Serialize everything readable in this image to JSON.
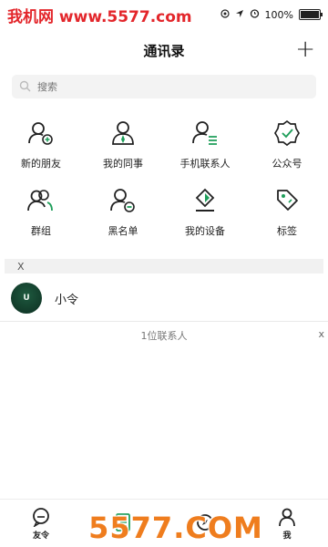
{
  "status_bar": {
    "watermark": "我机网 www.5577.com",
    "battery": "100%"
  },
  "header": {
    "title": "通讯录",
    "add_label": "+"
  },
  "search": {
    "placeholder": "搜索"
  },
  "functions": [
    {
      "label": "新的朋友",
      "icon": "add-friend-icon"
    },
    {
      "label": "我的同事",
      "icon": "colleague-icon"
    },
    {
      "label": "手机联系人",
      "icon": "phone-contacts-icon"
    },
    {
      "label": "公众号",
      "icon": "official-account-icon"
    },
    {
      "label": "群组",
      "icon": "group-icon"
    },
    {
      "label": "黑名单",
      "icon": "blacklist-icon"
    },
    {
      "label": "我的设备",
      "icon": "device-icon"
    },
    {
      "label": "标签",
      "icon": "tag-icon"
    }
  ],
  "section": {
    "letter": "X"
  },
  "contacts": [
    {
      "name": "小令",
      "avatar_text": "U"
    }
  ],
  "footer": {
    "count": "1位联系人",
    "close": "x"
  },
  "tabs": [
    {
      "label": "友令",
      "icon": "chat-icon"
    },
    {
      "label": "",
      "icon": "contacts-icon"
    },
    {
      "label": "",
      "icon": "discover-icon"
    },
    {
      "label": "我",
      "icon": "me-icon"
    }
  ],
  "watermark_bottom": "5577.COM",
  "colors": {
    "accent": "#1e9e5a",
    "watermark_red": "#e3262b",
    "watermark_orange": "#ef7d1e"
  }
}
